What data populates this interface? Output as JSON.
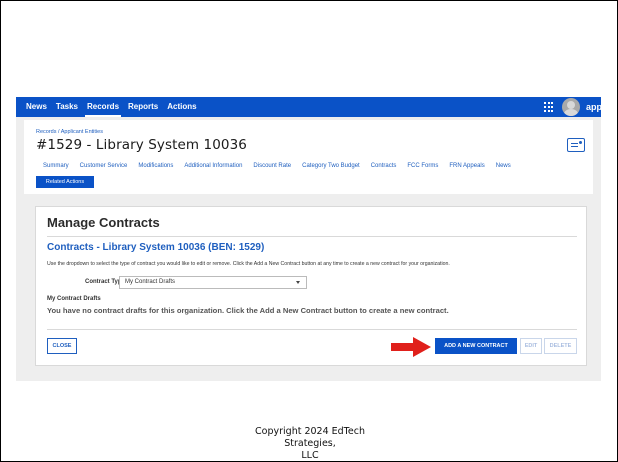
{
  "nav": {
    "items": [
      "News",
      "Tasks",
      "Records",
      "Reports",
      "Actions"
    ],
    "active": "Records",
    "brand": "appian",
    "bar_color": "#0a52c7"
  },
  "header": {
    "breadcrumb": "Records / Applicant Entities",
    "title": "#1529 - Library System 10036",
    "tabs": [
      "Summary",
      "Customer Service",
      "Modifications",
      "Additional Information",
      "Discount Rate",
      "Category Two Budget",
      "Contracts",
      "FCC Forms",
      "FRN Appeals",
      "News"
    ],
    "related_actions": "Related Actions"
  },
  "manage": {
    "title": "Manage Contracts",
    "section_title": "Contracts - Library System 10036 (BEN: 1529)",
    "instructions": "Use the dropdown to select the type of contract you would like to edit or remove. Click the Add a New Contract button at any time to create a new contract for your organization.",
    "contract_type_label": "Contract Type",
    "contract_type_value": "My Contract Drafts",
    "drafts_label": "My Contract Drafts",
    "drafts_message": "You have no contract drafts for this organization. Click the Add a New Contract button to create a new contract.",
    "buttons": {
      "close": "CLOSE",
      "add": "ADD A NEW CONTRACT",
      "edit": "EDIT",
      "delete": "DELETE"
    }
  },
  "footer": {
    "copyright_line1": "Copyright 2024 EdTech Strategies,",
    "copyright_line2": "LLC"
  },
  "colors": {
    "accent": "#0a52c7",
    "arrow": "#e0201b"
  }
}
